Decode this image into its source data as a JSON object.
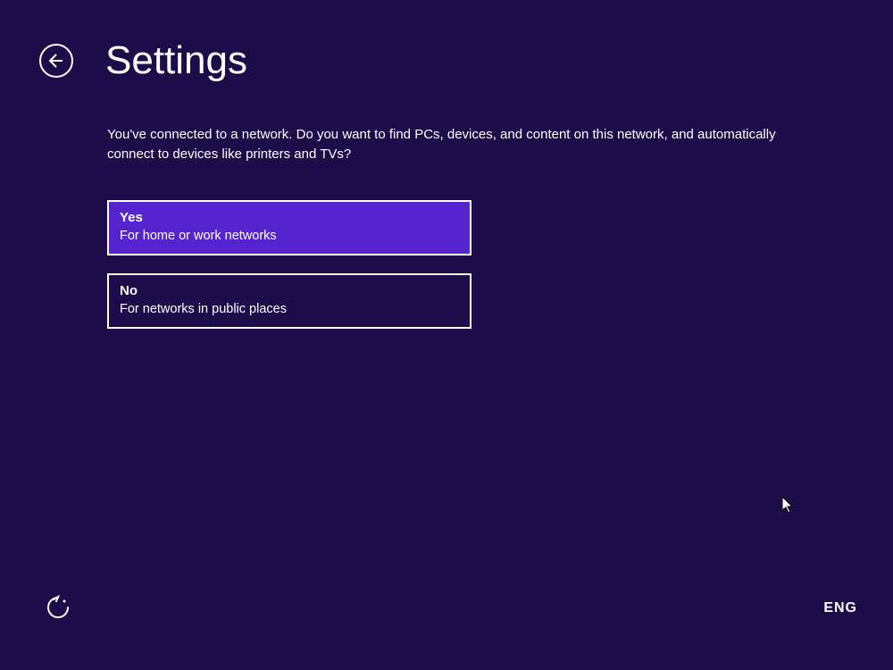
{
  "header": {
    "title": "Settings"
  },
  "prompt": "You've connected to a network. Do you want to find PCs, devices, and content on this network, and automatically connect to devices like printers and TVs?",
  "options": {
    "yes": {
      "title": "Yes",
      "subtitle": "For home or work networks"
    },
    "no": {
      "title": "No",
      "subtitle": "For networks in public places"
    }
  },
  "footer": {
    "language": "ENG"
  }
}
